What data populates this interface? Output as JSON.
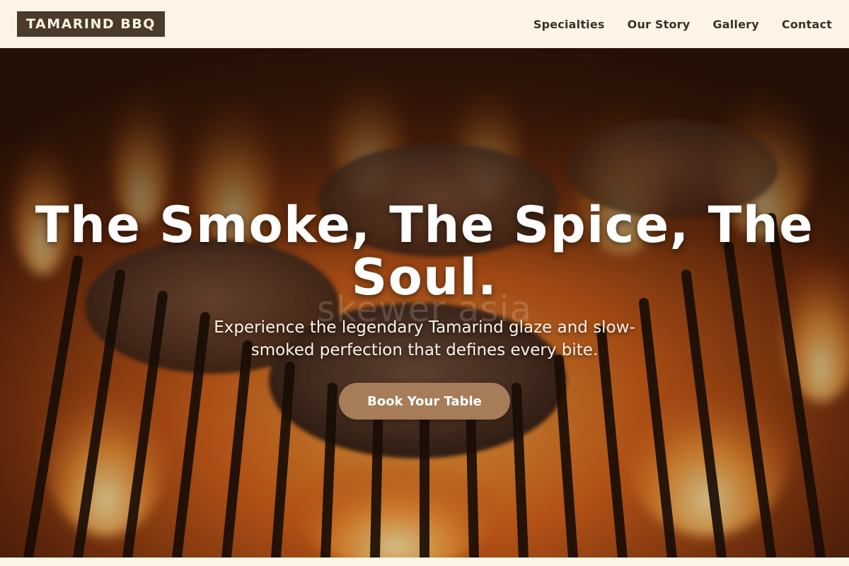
{
  "header": {
    "logo_text": "TAMARIND BBQ",
    "nav": [
      {
        "label": "Specialties"
      },
      {
        "label": "Our Story"
      },
      {
        "label": "Gallery"
      },
      {
        "label": "Contact"
      }
    ]
  },
  "hero": {
    "title": "The Smoke, The Spice, The Soul.",
    "subtitle": "Experience the legendary Tamarind glaze and slow-smoked perfection that defines every bite.",
    "cta_label": "Book Your Table",
    "watermark": "skewer asia",
    "background_image": "flaming-grill-with-meat-patties"
  },
  "colors": {
    "header_bg": "#fdf4e6",
    "logo_bg": "#4a3a2b",
    "nav_text": "#3e3025",
    "cta_bg": "#a67c59",
    "hero_text": "#ffffff"
  }
}
